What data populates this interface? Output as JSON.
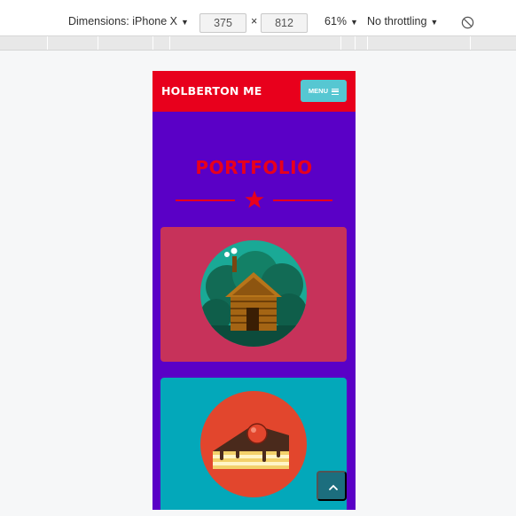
{
  "devtools": {
    "dimensions_label": "Dimensions: iPhone X",
    "width": "375",
    "times": "×",
    "height": "812",
    "zoom": "61%",
    "throttling": "No throttling",
    "caret": "▼",
    "rotate_icon": "rotate-icon"
  },
  "site": {
    "brand": "HOLBERTON ME",
    "menu_label": "MENU",
    "menu_icon": "hamburger-icon",
    "section_title": "PORTFOLIO",
    "divider_icon": "star-icon",
    "portfolio_items": [
      {
        "image": "log-cabin-illustration",
        "bg_color": "#c7325a"
      },
      {
        "image": "cake-slice-illustration",
        "bg_color": "#03a8ba"
      }
    ],
    "scroll_top_icon": "chevron-up-icon"
  },
  "colors": {
    "navbar": "#e8001c",
    "page_bg": "#5a00c6",
    "accent": "#e8001c",
    "menu_button": "#56c7d2",
    "scroll_top_button": "#1c6e7e"
  }
}
